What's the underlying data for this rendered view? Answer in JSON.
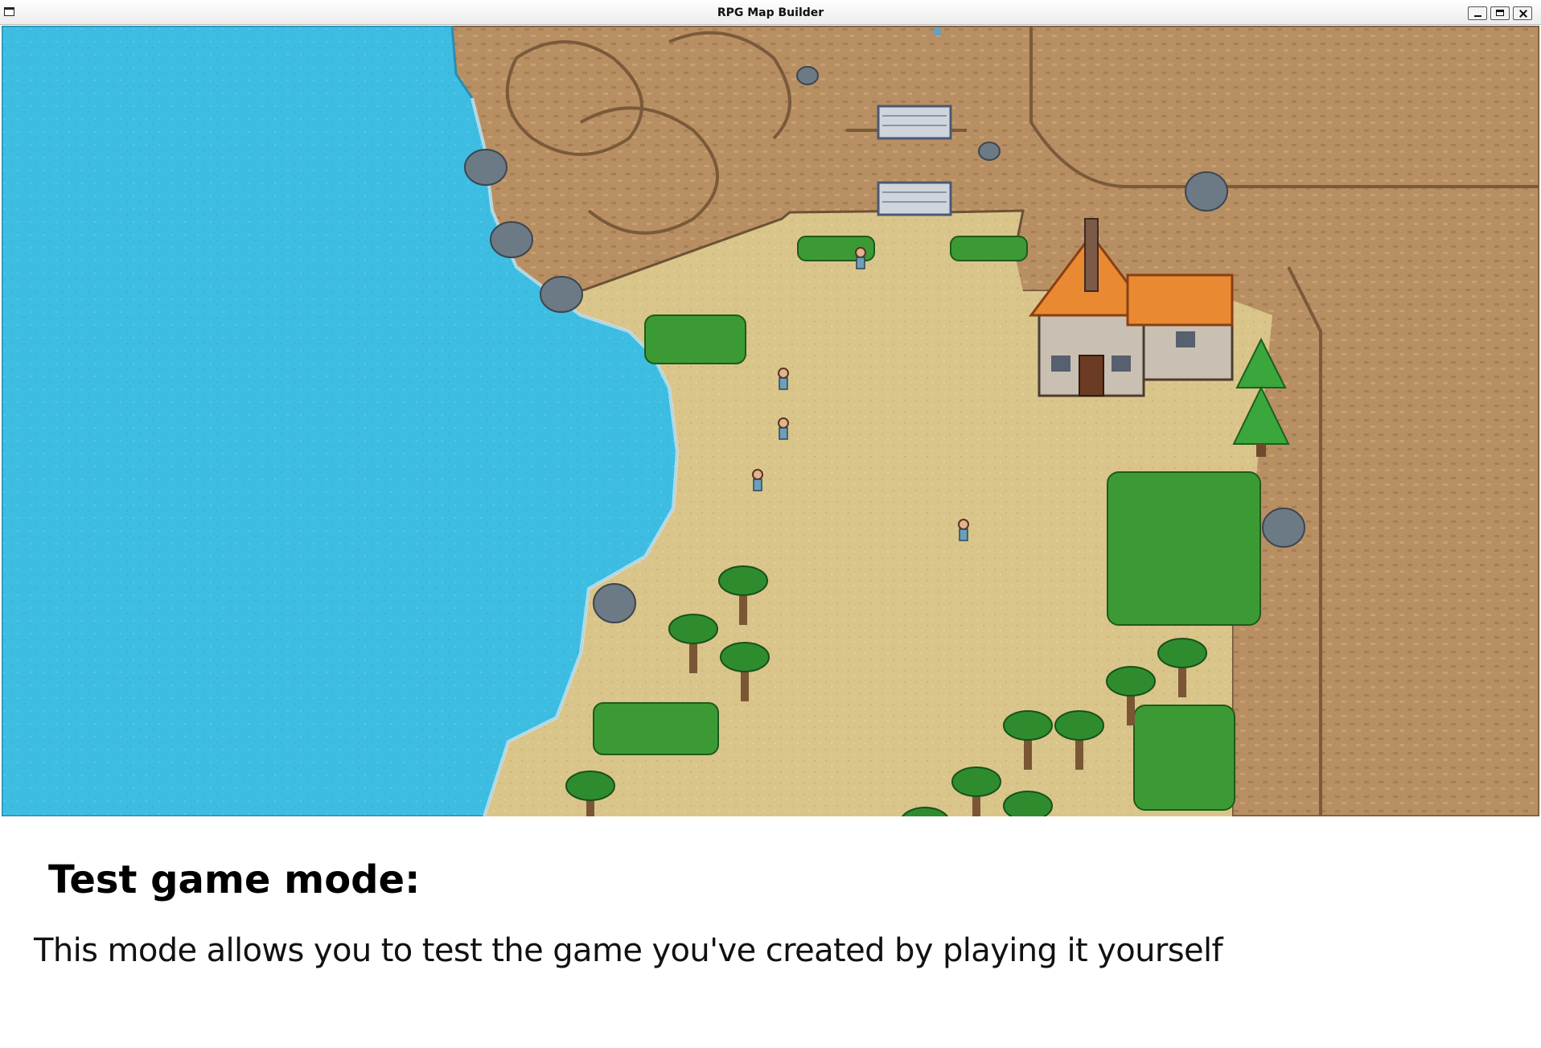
{
  "window": {
    "title": "RPG Map Builder",
    "controls": [
      "minimize",
      "maximize",
      "close"
    ]
  },
  "map": {
    "scene": "test-play-view",
    "tiles": [
      "water",
      "sand",
      "rocky-cliff",
      "stone-stairs",
      "house",
      "palm-tree",
      "pine-tree",
      "bush",
      "boulder",
      "villager"
    ],
    "colors": {
      "water": "#3ebde2",
      "sand": "#d9c48a",
      "cliff": "#b88f63",
      "roof": "#e98a32",
      "foliage": "#3c9a35"
    }
  },
  "caption": {
    "heading": "Test game mode:",
    "description": "This mode allows you to test the game you've created by playing it yourself"
  }
}
